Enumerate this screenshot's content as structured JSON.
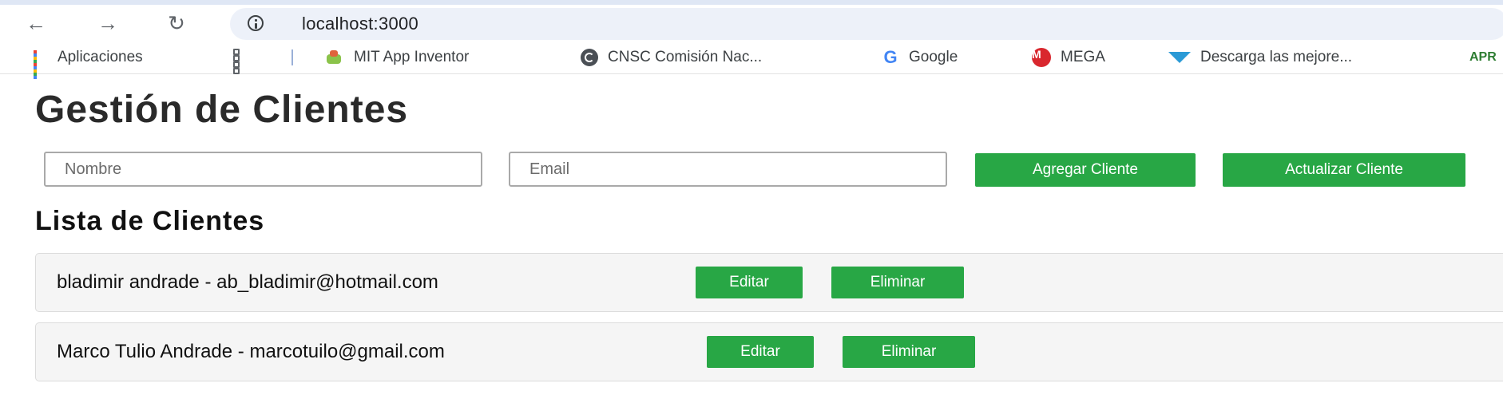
{
  "browser": {
    "url": "localhost:3000",
    "nav_icons": [
      "back-arrow-icon",
      "forward-arrow-icon",
      "reload-icon",
      "info-icon"
    ],
    "bookmarks": [
      {
        "label": "Aplicaciones",
        "icon": "apps-grid-icon"
      },
      {
        "label": "",
        "icon": "tab-groups-icon"
      },
      {
        "label": "MIT App Inventor",
        "icon": "mit-app-inventor-icon"
      },
      {
        "label": "CNSC Comisión Nac...",
        "icon": "cnsc-icon"
      },
      {
        "label": "Google",
        "icon": "google-icon"
      },
      {
        "label": "MEGA",
        "icon": "mega-icon"
      },
      {
        "label": "Descarga las mejore...",
        "icon": "download-icon"
      },
      {
        "label": "APR",
        "icon": "apr-icon"
      }
    ]
  },
  "page": {
    "title": "Gestión de Clientes",
    "form": {
      "name_placeholder": "Nombre",
      "email_placeholder": "Email",
      "add_label": "Agregar Cliente",
      "update_label": "Actualizar Cliente"
    },
    "list_title": "Lista de Clientes",
    "clients": [
      {
        "text": "bladimir andrade - ab_bladimir@hotmail.com",
        "edit_label": "Editar",
        "delete_label": "Eliminar"
      },
      {
        "text": "Marco Tulio Andrade - marcotuilo@gmail.com",
        "edit_label": "Editar",
        "delete_label": "Eliminar"
      }
    ]
  },
  "colors": {
    "button_green": "#28a745",
    "omnibox_bg": "#edf1f9",
    "card_bg": "#f5f5f5"
  }
}
